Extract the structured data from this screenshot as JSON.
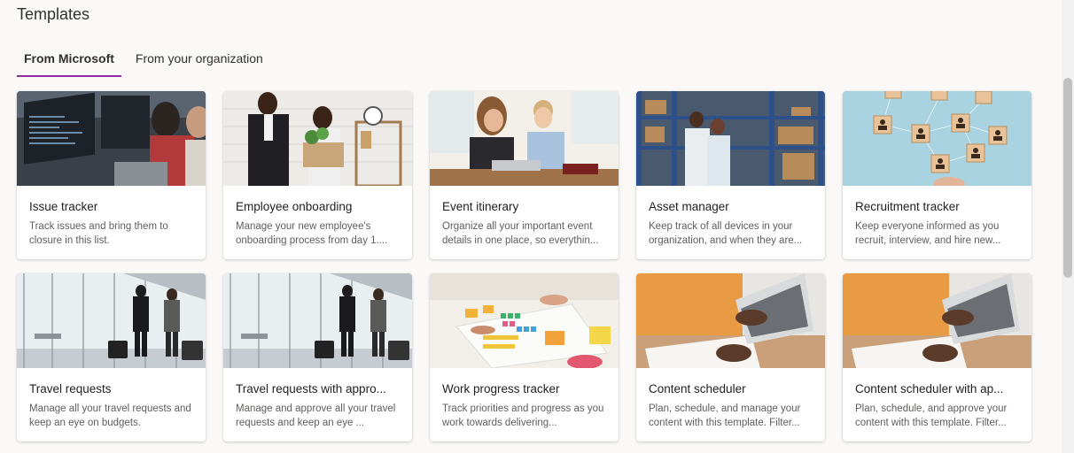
{
  "page": {
    "title": "Templates"
  },
  "tabs": [
    {
      "label": "From Microsoft",
      "active": true
    },
    {
      "label": "From your organization",
      "active": false
    }
  ],
  "templates": [
    {
      "title": "Issue tracker",
      "description": "Track issues and bring them to closure in this list."
    },
    {
      "title": "Employee onboarding",
      "description": "Manage your new employee's onboarding process from day 1...."
    },
    {
      "title": "Event itinerary",
      "description": "Organize all your important event details in one place, so everythin..."
    },
    {
      "title": "Asset manager",
      "description": "Keep track of all devices in your organization, and when they are..."
    },
    {
      "title": "Recruitment tracker",
      "description": "Keep everyone informed as you recruit, interview, and hire new..."
    },
    {
      "title": "Travel requests",
      "description": "Manage all your travel requests and keep an eye on budgets."
    },
    {
      "title": "Travel requests with appro...",
      "description": "Manage and approve all your travel requests and keep an eye ..."
    },
    {
      "title": "Work progress tracker",
      "description": "Track priorities and progress as you work towards delivering..."
    },
    {
      "title": "Content scheduler",
      "description": "Plan, schedule, and manage your content with this template. Filter..."
    },
    {
      "title": "Content scheduler with ap...",
      "description": "Plan, schedule, and approve your content with this template. Filter..."
    }
  ],
  "colors": {
    "accent": "#8a2da5",
    "background": "#faf9f8"
  }
}
